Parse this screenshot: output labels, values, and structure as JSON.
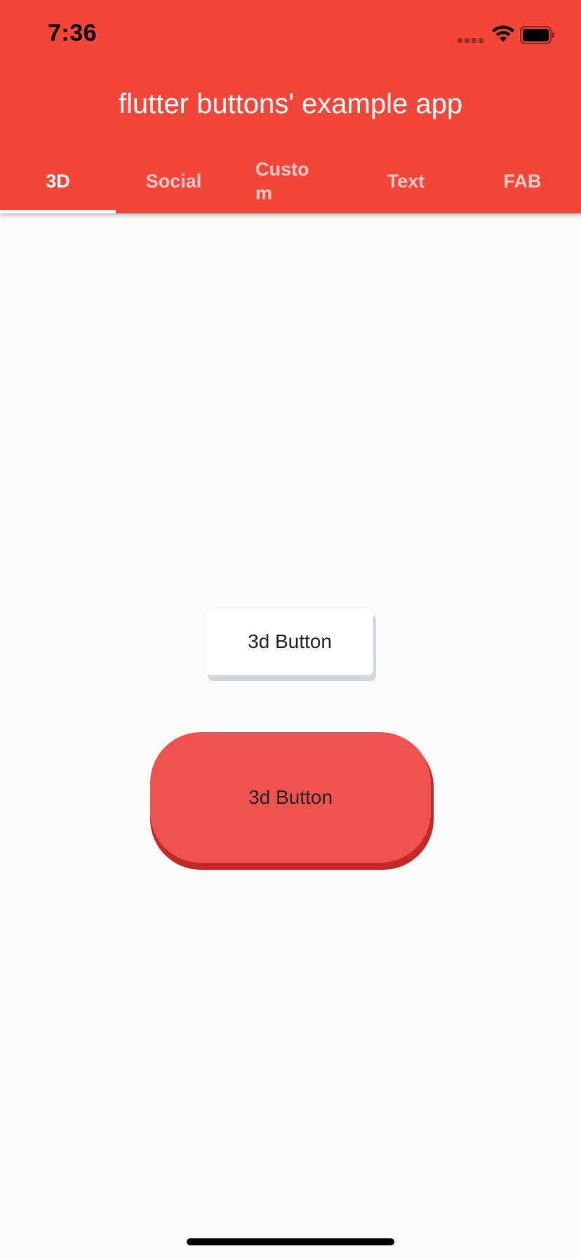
{
  "status_bar": {
    "time": "7:36"
  },
  "app_bar": {
    "title": "flutter buttons' example app",
    "background_color": "#f44539"
  },
  "tabs": [
    {
      "label": "3D",
      "active": true
    },
    {
      "label": "Social",
      "active": false
    },
    {
      "label": "Custom",
      "active": false
    },
    {
      "label": "Text",
      "active": false
    },
    {
      "label": "FAB",
      "active": false
    }
  ],
  "main": {
    "white_button": {
      "label": "3d Button",
      "face_color": "#ffffff",
      "shadow_color": "#cfd8dc"
    },
    "red_button": {
      "label": "3d Button",
      "face_color": "#ef5350",
      "shadow_color": "#c62828"
    }
  },
  "icons": [
    "signal-icon",
    "wifi-icon",
    "battery-icon"
  ]
}
